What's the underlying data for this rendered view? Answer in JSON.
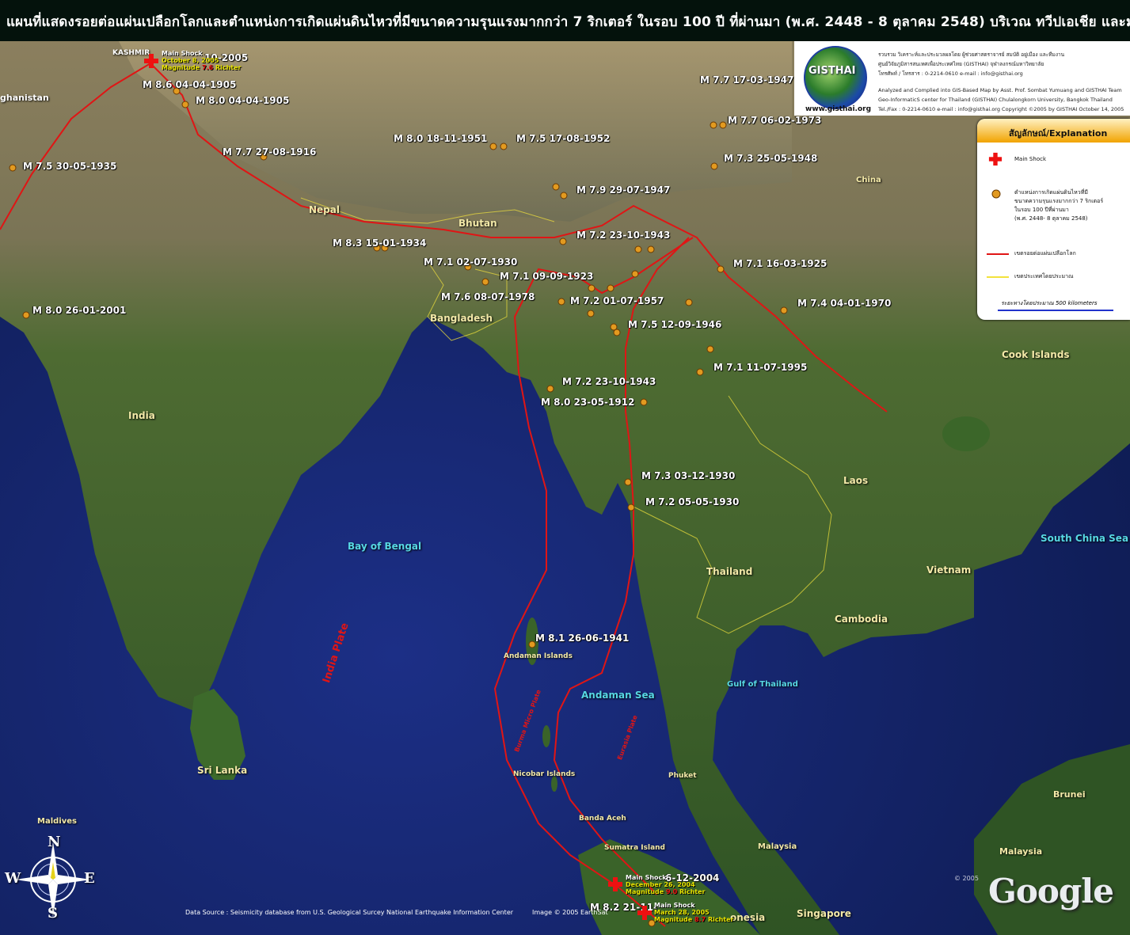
{
  "title": "แผนที่แสดงรอยต่อแผ่นเปลือกโลกและตำแหน่งการเกิดแผ่นดินไหวที่มีขนาดความรุนแรงมากกว่า 7 ริกเตอร์ ในรอบ 100 ปี ที่ผ่านมา (พ.ศ. 2448 - 8 ตุลาคม 2548) บริเวณ ทวีปเอเชีย และมหาสมุทรอินเดีย",
  "quakes": [
    {
      "text": "10-2005"
    },
    {
      "text": "M 8.6 04-04-1905"
    },
    {
      "text": "M 8.0 04-04-1905"
    },
    {
      "text": "M 7.7 27-08-1916"
    },
    {
      "text": "M 7.5 30-05-1935"
    },
    {
      "text": "M 8.0 18-11-1951"
    },
    {
      "text": "M 7.5 17-08-1952"
    },
    {
      "text": "M 7.7 17-03-1947"
    },
    {
      "text": "M 7.7 06-02-1973"
    },
    {
      "text": "M 7.3 25-05-1948"
    },
    {
      "text": "M 7.9 29-07-1947"
    },
    {
      "text": "M 8.3 15-01-1934"
    },
    {
      "text": "M 7.2 23-10-1943"
    },
    {
      "text": "M 7.1 02-07-1930"
    },
    {
      "text": "M 7.1 09-09-1923"
    },
    {
      "text": "M 7.1 16-03-1925"
    },
    {
      "text": "M 7.6 08-07-1978"
    },
    {
      "text": "M 7.2 01-07-1957"
    },
    {
      "text": "M 7.4 04-01-1970"
    },
    {
      "text": "M 7.5 12-09-1946"
    },
    {
      "text": "M 8.0 26-01-2001"
    },
    {
      "text": "M 7.1 11-07-1995"
    },
    {
      "text": "M 7.2 23-10-1943"
    },
    {
      "text": "M 8.0 23-05-1912"
    },
    {
      "text": "M 7.3 03-12-1930"
    },
    {
      "text": "M 7.2 05-05-1930"
    },
    {
      "text": "M 8.1 26-06-1941"
    },
    {
      "text": "6-12-2004"
    },
    {
      "text": "M 8.2 21-11-"
    }
  ],
  "places": {
    "kashmir": "KASHMIR",
    "afghanistan": "ghanistan",
    "nepal": "Nepal",
    "bhutan": "Bhutan",
    "china": "China",
    "bangladesh": "Bangladesh",
    "india": "India",
    "bay_of_bengal": "Bay of Bengal",
    "cook_islands": "Cook Islands",
    "laos": "Laos",
    "south_china_sea": "South China Sea",
    "thailand": "Thailand",
    "vietnam": "Vietnam",
    "cambodia": "Cambodia",
    "andaman_islands": "Andaman Islands",
    "india_plate": "India Plate",
    "andaman_sea": "Andaman Sea",
    "gulf_of_thailand": "Gulf of Thailand",
    "burma_micro_plate": "Burma Micro Plate",
    "eurasia_plate": "Eurasia Plate",
    "nicobar_islands": "Nicobar Islands",
    "phuket": "Phuket",
    "sri_lanka": "Sri Lanka",
    "brunei": "Brunei",
    "maldives": "Maldives",
    "banda_aceh": "Banda Aceh",
    "sumatra_island": "Sumatra Island",
    "malaysia_west": "Malaysia",
    "malaysia_east": "Malaysia",
    "singapore": "Singapore",
    "indonesia": "onesia"
  },
  "main_shocks": {
    "kashmir": {
      "label": "Main Shock",
      "date": "October 8, 2005",
      "magnitude_prefix": "Magnitude ",
      "magnitude": "7.6",
      "unit": " Richter"
    },
    "sumatra_2004": {
      "label": "Main Shock",
      "date": "December 26, 2004",
      "magnitude_prefix": "Magnitude ",
      "magnitude": "9.0",
      "unit": " Richter"
    },
    "sumatra_2005": {
      "label": "Main Shock",
      "date": "March 28, 2005",
      "magnitude_prefix": "Magnitude ",
      "magnitude": "8.7",
      "unit": " Richter"
    }
  },
  "logo": {
    "name": "GISTHAI",
    "url": "www.gisthai.org",
    "credits": [
      "รวบรวม วิเคราะห์และประมวลผลโดย ผู้ช่วยศาสตราจารย์ สมบัติ อยู่เมือง และทีมงาน",
      "ศูนย์วิจัยภูมิสารสนเทศเพื่อประเทศไทย (GISTHAI) จุฬาลงกรณ์มหาวิทยาลัย",
      "โทรศัพท์ / โทรสาร : 0-2214-0610    e-mail : info@gisthai.org",
      "Analyzed and Complied into GIS-Based Map by Asst. Prof. Sombat Yumuang and GISTHAI Team",
      "Geo-InformaticS center for Thailand (GISTHAI) Chulalongkorn University, Bangkok Thailand",
      "Tel./Fax : 0-2214-0610   e-mail : info@gisthai.org   Copyright ©2005 by GISTHAI      October 14, 2005"
    ]
  },
  "legend": {
    "title": "สัญลักษณ์/Explanation",
    "main_shock": "Main Shock",
    "quake_line1": "ตำแหน่งการเกิดแผ่นดินไหวที่มี",
    "quake_line2": "ขนาดความรุนแรงมากกว่า 7 ริกเตอร์",
    "quake_line3": "ในรอบ 100 ปีที่ผ่านมา",
    "quake_line4": "(พ.ศ. 2448- 8 ตุลาคม 2548)",
    "plate_boundary": "เขตรอยต่อแผ่นเปลือกโลก",
    "country_boundary": "เขตประเทศโดยประมาณ",
    "scale": "ระยะทางโดยประมาณ 500 kilometers",
    "colors": {
      "plate": "#e01515",
      "country": "#f2e23c",
      "scale": "#2233cc"
    }
  },
  "footer": {
    "data_source": "Data Source : Seismicity database from U.S. Geological Surcey National Earthquake Information Center",
    "image_credit": "Image © 2005 EarthSat",
    "google_copyright": "© 2005",
    "google": "Google"
  },
  "compass": {
    "n": "N",
    "s": "S",
    "e": "E",
    "w": "W"
  }
}
